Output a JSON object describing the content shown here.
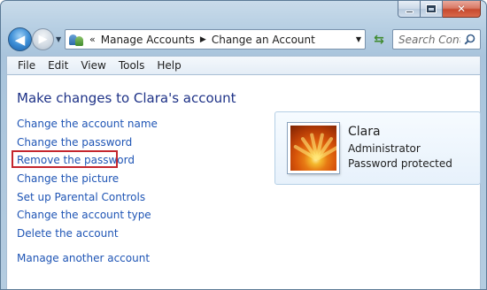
{
  "window": {
    "caption_buttons": {
      "minimize_icon": "minimize-icon",
      "maximize_icon": "maximize-icon",
      "close_icon": "close-icon",
      "close_glyph": "✕"
    }
  },
  "navigation": {
    "back_icon": "back-arrow-icon",
    "forward_icon": "forward-arrow-icon",
    "back_glyph": "◀",
    "forward_glyph": "▶"
  },
  "address_bar": {
    "overflow_indicator": "«",
    "breadcrumbs": [
      {
        "label": "Manage Accounts"
      },
      {
        "label": "Change an Account"
      }
    ],
    "separator_glyph": "▶",
    "dropdown_glyph": "▼"
  },
  "refresh": {
    "glyph": "⇆"
  },
  "search": {
    "placeholder": "Search Cont..."
  },
  "menu_bar": {
    "items": [
      "File",
      "Edit",
      "View",
      "Tools",
      "Help"
    ]
  },
  "main": {
    "title": "Make changes to Clara's account",
    "tasks": [
      {
        "label": "Change the account name"
      },
      {
        "label": "Change the password"
      },
      {
        "label": "Remove the password",
        "highlighted": true
      },
      {
        "label": "Change the picture"
      },
      {
        "label": "Set up Parental Controls"
      },
      {
        "label": "Change the account type"
      },
      {
        "label": "Delete the account"
      }
    ],
    "other_task": {
      "label": "Manage another account"
    }
  },
  "account": {
    "name": "Clara",
    "role": "Administrator",
    "status": "Password protected",
    "picture": "flower-account-picture"
  },
  "colors": {
    "link": "#1f55b5",
    "title": "#1e3287",
    "highlight": "#c4262e",
    "close_button": "#c74a2f"
  }
}
